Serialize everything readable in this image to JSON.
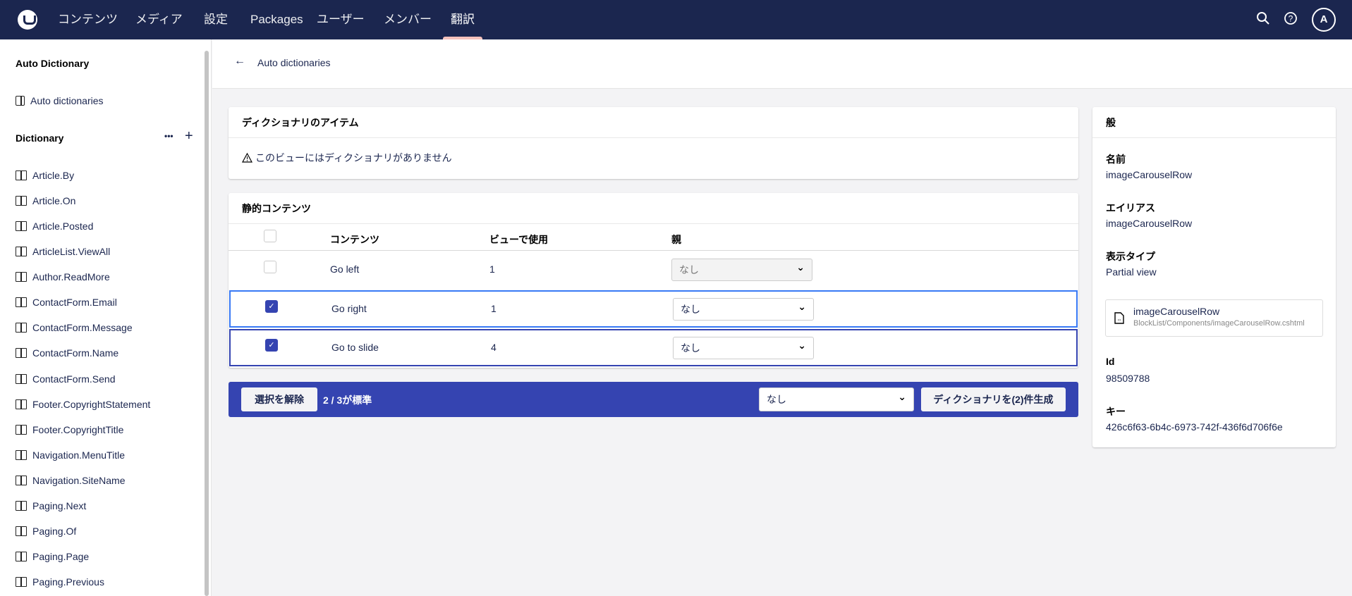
{
  "topnav": {
    "items": [
      "コンテンツ",
      "メディア",
      "設定",
      "Packages",
      "ユーザー",
      "メンバー",
      "翻訳"
    ],
    "active": "翻訳",
    "avatar": "A"
  },
  "sidebar": {
    "section_title": "Auto Dictionary",
    "auto_link": "Auto dictionaries",
    "dictionary_title": "Dictionary",
    "more": "•••",
    "add": "+",
    "items": [
      "Article.By",
      "Article.On",
      "Article.Posted",
      "ArticleList.ViewAll",
      "Author.ReadMore",
      "ContactForm.Email",
      "ContactForm.Message",
      "ContactForm.Name",
      "ContactForm.Send",
      "Footer.CopyrightStatement",
      "Footer.CopyrightTitle",
      "Navigation.MenuTitle",
      "Navigation.SiteName",
      "Paging.Next",
      "Paging.Of",
      "Paging.Page",
      "Paging.Previous"
    ]
  },
  "header": {
    "back_label": "Auto dictionaries"
  },
  "dict_card": {
    "title": "ディクショナリのアイテム",
    "warning": "このビューにはディクショナリがありません"
  },
  "static_card": {
    "title": "静的コンテンツ",
    "columns": [
      "コンテンツ",
      "ビューで使用",
      "親"
    ],
    "rows": [
      {
        "content": "Go left",
        "uses": "1",
        "parent": "なし",
        "checked": false
      },
      {
        "content": "Go right",
        "uses": "1",
        "parent": "なし",
        "checked": true
      },
      {
        "content": "Go to slide",
        "uses": "4",
        "parent": "なし",
        "checked": true
      }
    ]
  },
  "action_bar": {
    "clear_label": "選択を解除",
    "count": "2 / 3が標準",
    "parent_select": "なし",
    "generate_label": "ディクショナリを(2)件生成"
  },
  "info": {
    "title": "般",
    "name_label": "名前",
    "name": "imageCarouselRow",
    "alias_label": "エイリアス",
    "alias": "imageCarouselRow",
    "type_label": "表示タイプ",
    "type": "Partial view",
    "file_name": "imageCarouselRow",
    "file_path": "BlockList/Components/imageCarouselRow.cshtml",
    "id_label": "Id",
    "id": "98509788",
    "key_label": "キー",
    "key": "426c6f63-6b4c-6973-742f-436f6d706f6e"
  },
  "colors": {
    "header": "#1b264f",
    "accent": "#3544b1",
    "focus": "#3879f5"
  }
}
